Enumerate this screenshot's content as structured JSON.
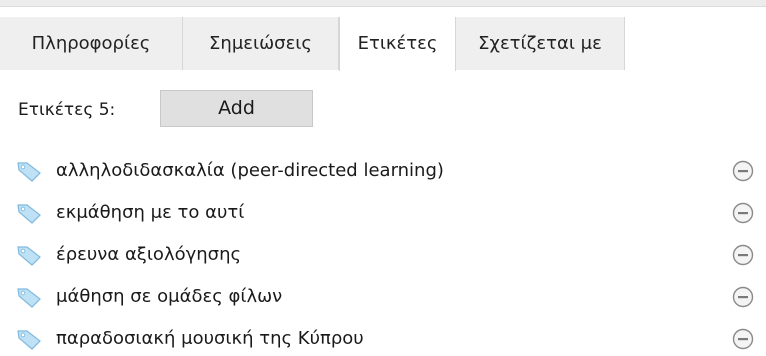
{
  "tabs": [
    {
      "label": "Πληροφορίες",
      "active": false
    },
    {
      "label": "Σημειώσεις",
      "active": false
    },
    {
      "label": "Ετικέτες",
      "active": true
    },
    {
      "label": "Σχετίζεται με",
      "active": false
    }
  ],
  "tags_header": {
    "count_label": "Ετικέτες 5:",
    "add_label": "Add"
  },
  "tags": [
    {
      "label": "αλληλοδιδασκαλία (peer-directed learning)",
      "icon": "tag-icon"
    },
    {
      "label": "εκμάθηση με το αυτί",
      "icon": "tag-icon"
    },
    {
      "label": "έρευνα αξιολόγησης",
      "icon": "tag-icon"
    },
    {
      "label": "μάθηση σε ομάδες φίλων",
      "icon": "tag-icon"
    },
    {
      "label": "παραδοσιακή μουσική της Κύπρου",
      "icon": "tag-icon"
    }
  ],
  "colors": {
    "tag_icon": "#8ec6e8",
    "remove_icon": "#8a8a8a",
    "tab_inactive_bg": "#efefef",
    "button_bg": "#e0e0e0"
  }
}
